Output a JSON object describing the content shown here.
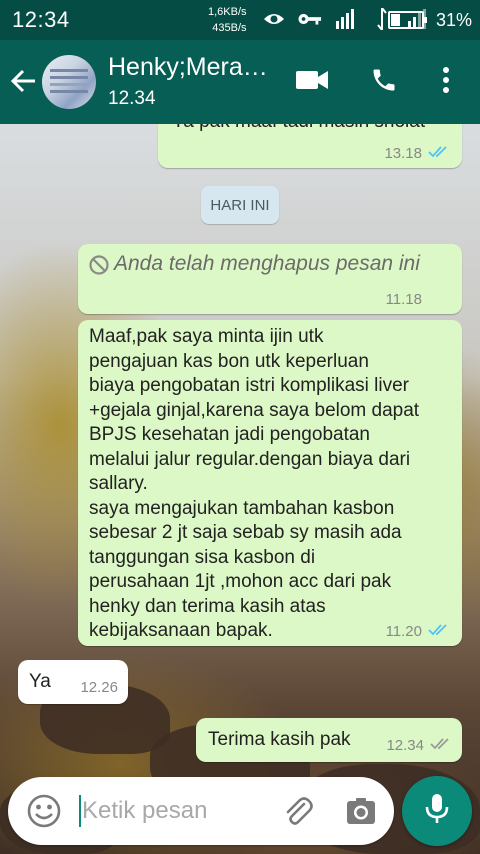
{
  "status_bar": {
    "time": "12:34",
    "net_up": "1,6KB/s",
    "net_down": "435B/s",
    "battery_percent": "31%",
    "battery_level": 0.31
  },
  "header": {
    "title": "Henky;Mera…",
    "subtitle": "12.34",
    "back_icon": "arrow-left-icon",
    "video_icon": "video-camera-icon",
    "call_icon": "phone-icon",
    "menu_icon": "more-vert-icon"
  },
  "messages": {
    "partial": {
      "text": "Ya pak maaf tadi masih sholat",
      "time": "13.18"
    },
    "date_chip": "HARI INI",
    "deleted": {
      "text": "Anda telah menghapus pesan ini",
      "time": "11.18"
    },
    "long": {
      "lines": [
        "Maaf,pak saya minta ijin utk",
        "pengajuan kas bon utk keperluan",
        "biaya pengobatan istri komplikasi liver",
        "+gejala ginjal,karena saya belom dapat",
        "BPJS kesehatan jadi pengobatan",
        "melalui jalur regular.dengan biaya dari",
        "sallary.",
        "saya mengajukan tambahan kasbon",
        "sebesar 2 jt saja sebab sy masih ada",
        "tanggungan sisa kasbon di",
        "perusahaan 1jt ,mohon acc dari pak",
        "henky dan terima kasih atas",
        "kebijaksanaan bapak."
      ],
      "time": "11.20"
    },
    "reply": {
      "text": "Ya",
      "time": "12.26"
    },
    "thanks": {
      "text": "Terima kasih pak",
      "time": "12.34"
    }
  },
  "composer": {
    "placeholder": "Ketik pesan",
    "value": "",
    "emoji_icon": "emoji-icon",
    "attach_icon": "paperclip-icon",
    "camera_icon": "camera-icon",
    "mic_icon": "microphone-icon"
  },
  "colors": {
    "status_bar": "#054d44",
    "app_bar": "#075e54",
    "outgoing_bubble": "#dcf8c6",
    "incoming_bubble": "#ffffff",
    "read_tick": "#4fc3f7",
    "accent": "#0b8a7a"
  }
}
